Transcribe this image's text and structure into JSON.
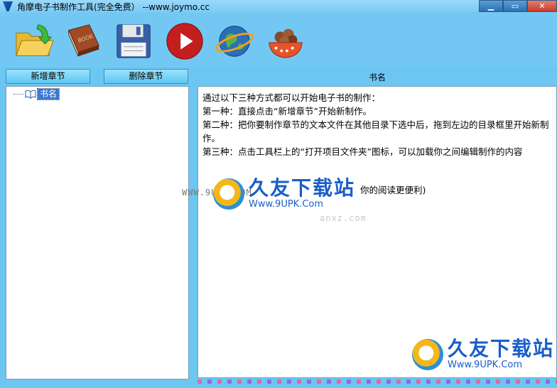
{
  "window": {
    "title": "角摩电子书制作工具(完全免费）  --www.joymo.cc",
    "minimize_label": "▁",
    "maximize_label": "▭",
    "close_label": "✕"
  },
  "toolbar": {
    "buttons": [
      {
        "icon": "open-folder-icon"
      },
      {
        "icon": "book-icon"
      },
      {
        "icon": "save-disk-icon"
      },
      {
        "icon": "play-icon"
      },
      {
        "icon": "globe-icon"
      },
      {
        "icon": "bowl-icon"
      }
    ]
  },
  "actions": {
    "add_chapter": "新增章节",
    "delete_chapter": "删除章节"
  },
  "tree": {
    "root_label": "书名"
  },
  "content": {
    "header": "书名",
    "lines": [
      "通过以下三种方式都可以开始电子书的制作：",
      "第一种：直接点击“新增章节”开始新制作。",
      "第二种：把你要制作章节的文本文件在其他目录下选中后，拖到左边的目录框里开始新制作。",
      "第三种：点击工具栏上的“打开项目文件夹”图标，可以加载你之间编辑制作的内容",
      "",
      "你的阅读更便利)"
    ]
  },
  "watermarks": {
    "brand": "久友下载站",
    "url": "Www.9UPK.Com",
    "faint_left": "WWW.9UPK.COM",
    "faint_right": "anxz.com"
  },
  "colors": {
    "background": "#6cc6f2",
    "tree_selection": "#3a78d4",
    "watermark": "#1a5ec8"
  }
}
